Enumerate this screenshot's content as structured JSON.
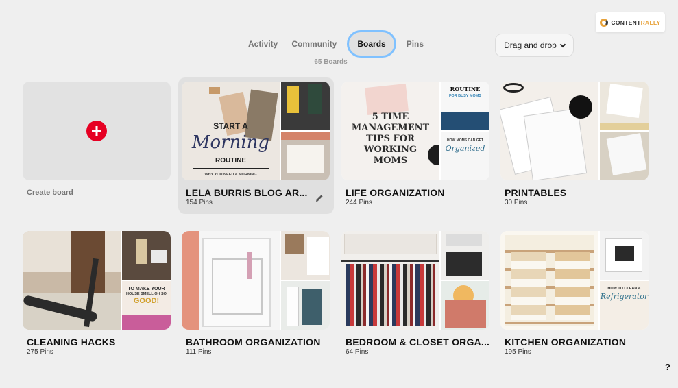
{
  "logo": {
    "part1": "CONTENT",
    "part2": "RALLY"
  },
  "tabs": [
    "Activity",
    "Community",
    "Boards",
    "Pins"
  ],
  "active_tab": "Boards",
  "board_count": "65 Boards",
  "dragdrop": {
    "label": "Drag and drop"
  },
  "create_board": {
    "label": "Create board"
  },
  "boards": [
    {
      "title": "LELA BURRIS BLOG AR...",
      "pins": "154 Pins",
      "cover_text": [
        "START A",
        "Morning",
        "ROUTINE",
        "WHY YOU NEED A MORNING"
      ]
    },
    {
      "title": "LIFE ORGANIZATION",
      "pins": "244 Pins",
      "cover_text": [
        "5 TIME",
        "MANAGEMENT",
        "TIPS FOR",
        "WORKING",
        "MOMS"
      ],
      "side_text": [
        "ROUTINE",
        "FOR BUSY MOMS",
        "HOW MOMS CAN GET",
        "Organized"
      ]
    },
    {
      "title": "PRINTABLES",
      "pins": "30 Pins"
    },
    {
      "title": "CLEANING HACKS",
      "pins": "275 Pins",
      "side_text": [
        "TO MAKE YOUR",
        "HOUSE SMELL OH SO",
        "GOOD!"
      ]
    },
    {
      "title": "BATHROOM ORGANIZATION",
      "pins": "111 Pins"
    },
    {
      "title": "BEDROOM & CLOSET ORGA...",
      "pins": "64 Pins"
    },
    {
      "title": "KITCHEN ORGANIZATION",
      "pins": "195 Pins",
      "side_text": [
        "HOW TO CLEAN A",
        "Refrigerator"
      ]
    }
  ],
  "help": "?"
}
